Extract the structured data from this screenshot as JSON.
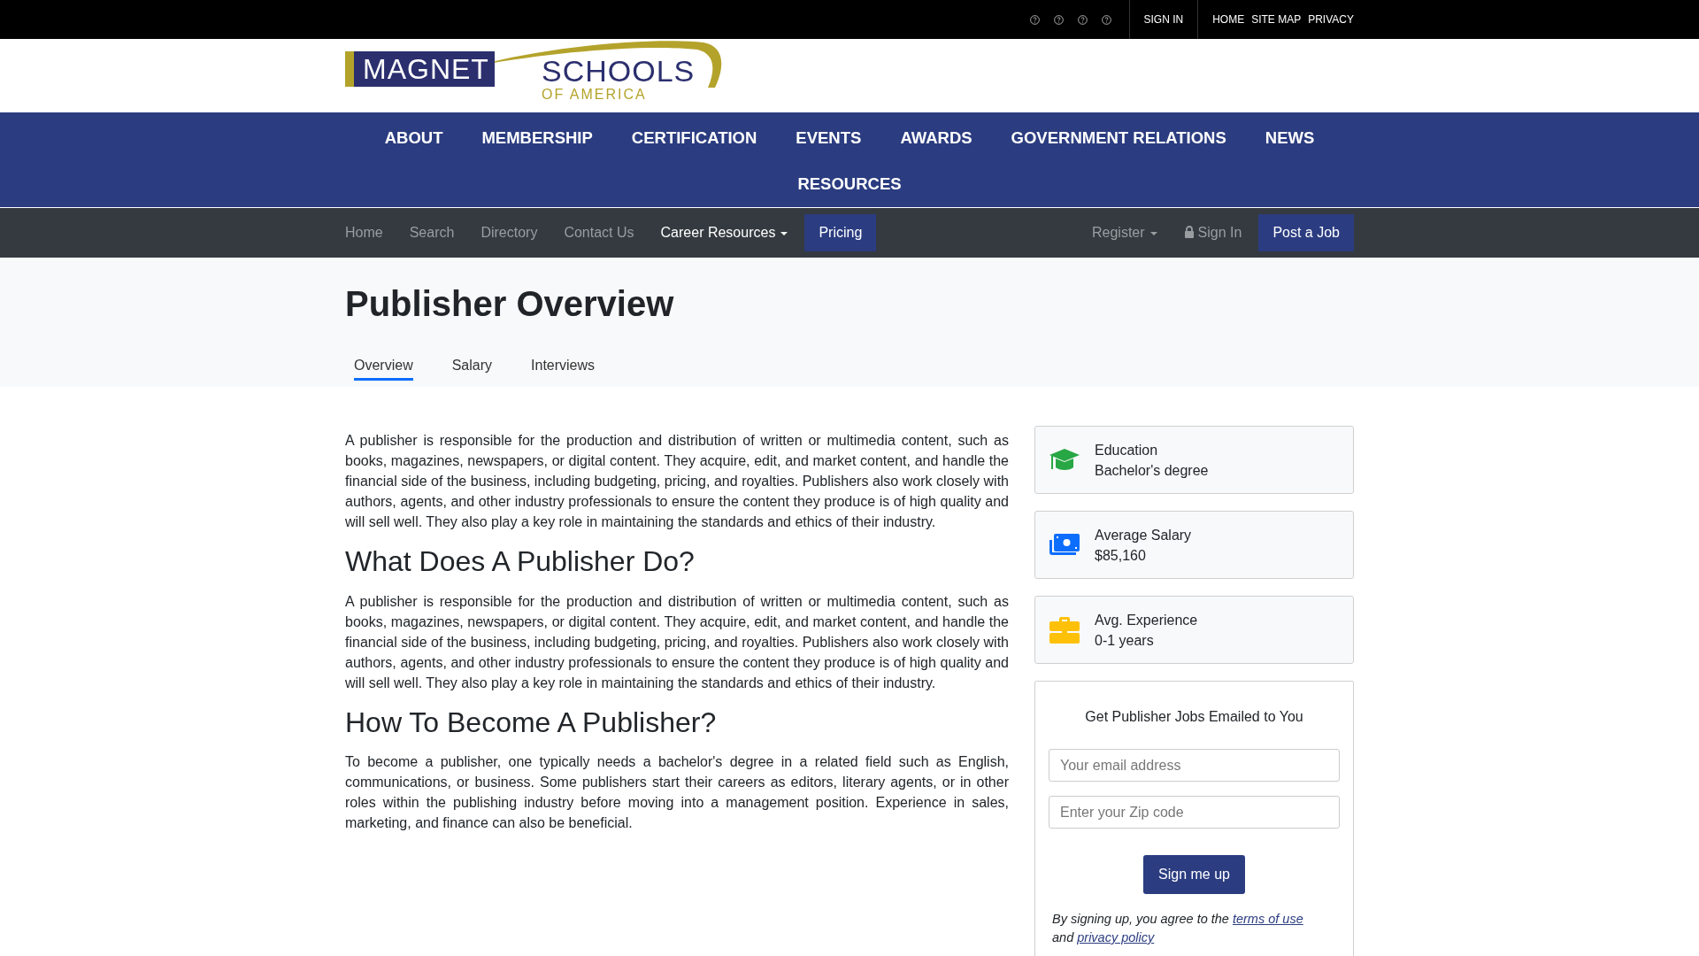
{
  "top_bar": {
    "sign_in": "SIGN IN",
    "links": [
      "HOME",
      "SITE MAP",
      "PRIVACY"
    ]
  },
  "logo": {
    "word": "MAGNET",
    "second_word": "SCHOOLS",
    "tagline": "OF AMERICA"
  },
  "main_nav": {
    "items": [
      "ABOUT",
      "MEMBERSHIP",
      "CERTIFICATION",
      "EVENTS",
      "AWARDS",
      "GOVERNMENT RELATIONS",
      "NEWS",
      "RESOURCES"
    ]
  },
  "sub_nav": {
    "left": [
      {
        "label": "Home",
        "kind": "link",
        "selected": false
      },
      {
        "label": "Search",
        "kind": "link",
        "selected": false
      },
      {
        "label": "Directory",
        "kind": "link",
        "selected": false
      },
      {
        "label": "Contact Us",
        "kind": "link",
        "selected": false
      },
      {
        "label": "Career Resources",
        "kind": "dropdown",
        "selected": true
      },
      {
        "label": "Pricing",
        "kind": "button",
        "selected": false
      }
    ],
    "right": [
      {
        "label": "Register",
        "kind": "dropdown",
        "selected": false
      },
      {
        "label": "Sign In",
        "kind": "lock",
        "selected": false
      },
      {
        "label": "Post a Job",
        "kind": "button",
        "selected": false
      }
    ]
  },
  "page_header": {
    "title": "Publisher Overview",
    "tabs": [
      {
        "label": "Overview",
        "selected": true
      },
      {
        "label": "Salary",
        "selected": false
      },
      {
        "label": "Interviews",
        "selected": false
      }
    ]
  },
  "article": [
    {
      "paragraph": "A publisher is responsible for the production and distribution of written or multimedia content, such as books, magazines, newspapers, or digital content. They acquire, edit, and market content, and handle the financial side of the business, including budgeting, pricing, and royalties. Publishers also work closely with authors, agents, and other industry professionals to ensure the content they produce is of high quality and will sell well. They also play a key role in maintaining the standards and ethics of their industry."
    },
    {
      "heading": "What Does A Publisher Do?",
      "paragraph": "A publisher is responsible for the production and distribution of written or multimedia content, such as books, magazines, newspapers, or digital content. They acquire, edit, and market content, and handle the financial side of the business, including budgeting, pricing, and royalties. Publishers also work closely with authors, agents, and other industry professionals to ensure the content they produce is of high quality and will sell well. They also play a key role in maintaining the standards and ethics of their industry."
    },
    {
      "heading": "How To Become A Publisher?",
      "paragraph": "To become a publisher, one typically needs a bachelor's degree in a related field such as English, communications, or business. Some publishers start their careers as editors, literary agents, or in other roles within the publishing industry before moving into a management position. Experience in sales, marketing, and finance can also be beneficial."
    }
  ],
  "facts": [
    {
      "kind": "education",
      "label": "Education",
      "value": "Bachelor's degree"
    },
    {
      "kind": "salary",
      "label": "Average Salary",
      "value": "$85,160"
    },
    {
      "kind": "experience",
      "label": "Avg. Experience",
      "value": "0-1 years"
    }
  ],
  "signup": {
    "title": "Get Publisher Jobs Emailed to You",
    "email_placeholder": "Your email address",
    "zip_placeholder": "Enter your Zip code",
    "button": "Sign me up",
    "terms": [
      "By signing up, you agree to the",
      "terms of use",
      "and",
      "privacy policy"
    ]
  }
}
